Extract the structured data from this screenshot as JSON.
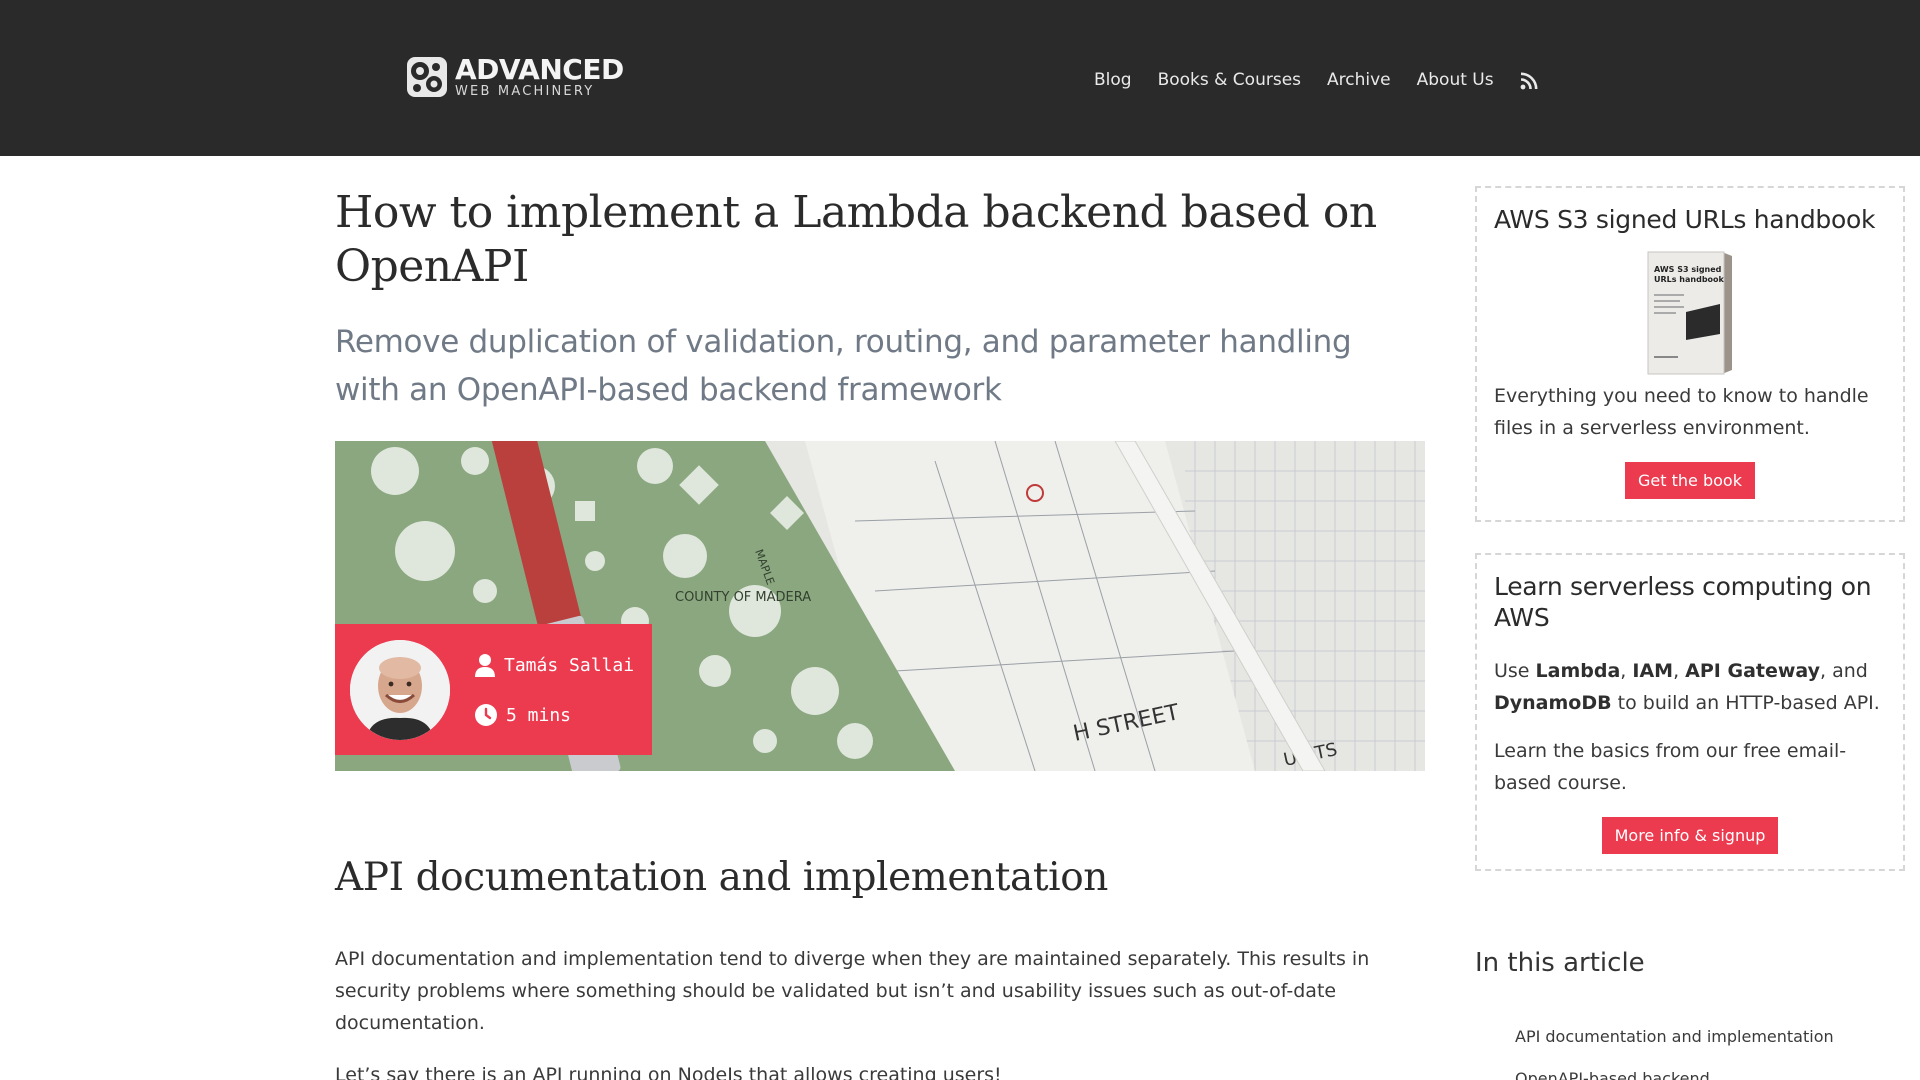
{
  "header": {
    "logo_line1": "ADVANCED",
    "logo_line2": "WEB MACHINERY",
    "nav": [
      {
        "label": "Blog"
      },
      {
        "label": "Books & Courses"
      },
      {
        "label": "Archive"
      },
      {
        "label": "About Us"
      }
    ],
    "rss_icon": "rss-icon"
  },
  "article": {
    "title": "How to implement a Lambda backend based on OpenAPI",
    "subtitle": "Remove duplication of validation, routing, and parameter handling with an OpenAPI-based backend framework",
    "hero_image_labels": [
      "H STREET",
      "UNITS",
      "COUNTY OF MADERA",
      "MAPLE"
    ],
    "author": "Tamás Sallai",
    "read_time": "5 mins",
    "sections": [
      {
        "heading": "API documentation and implementation",
        "paragraphs": [
          "API documentation and implementation tend to diverge when they are maintained separately. This results in security problems where something should be validated but isn’t and usability issues such as out-of-date documentation.",
          "Let’s say there is an API running on NodeJs that allows creating users!"
        ]
      }
    ]
  },
  "sidebar": {
    "book": {
      "title": "AWS S3 signed URLs handbook",
      "cover_text": "AWS S3 signed URLs handbook",
      "text": "Everything you need to know to handle files in a serverless environment.",
      "button": "Get the book"
    },
    "course": {
      "title": "Learn serverless computing on AWS",
      "text1_parts": {
        "use": "Use ",
        "lambda": "Lambda",
        "comma1": ", ",
        "iam": "IAM",
        "comma2": ", ",
        "apigw": "API Gateway",
        "and": ", and ",
        "dynamo": "DynamoDB",
        "rest": " to build an HTTP-based API."
      },
      "text2": "Learn the basics from our free email-based course.",
      "button": "More info & signup"
    },
    "toc": {
      "title": "In this article",
      "items": [
        {
          "label": "API documentation and implementation"
        },
        {
          "label": "OpenAPI-based backend"
        }
      ]
    }
  },
  "colors": {
    "header_bg": "#2a2a2a",
    "accent": "#ec3a4f",
    "subtitle": "#707a86",
    "hero_green": "#8aa77f"
  }
}
